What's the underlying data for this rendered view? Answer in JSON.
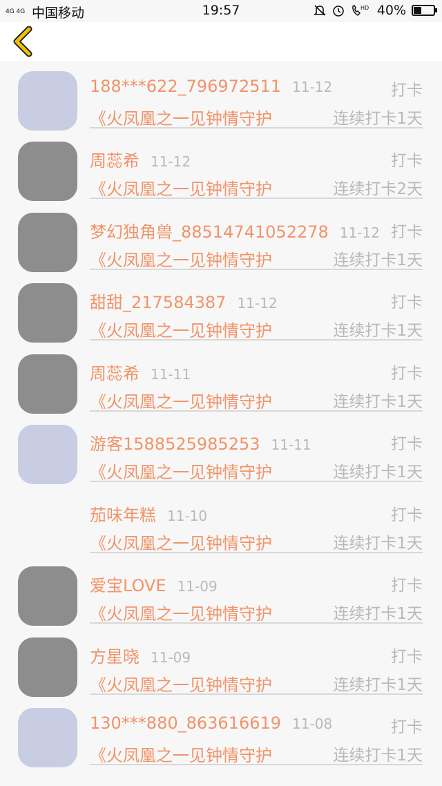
{
  "status_bar": {
    "signal": "4G 4G",
    "carrier": "中国移动",
    "time": "19:57",
    "icons": [
      "silent-icon",
      "alarm-icon",
      "hd-call-icon"
    ],
    "hd_label": "HD",
    "battery": "40%",
    "battery_level": 0.4
  },
  "header": {
    "back_icon": "chevron-left-icon",
    "accent": "#f2c200"
  },
  "rows": [
    {
      "name": "",
      "date": "",
      "book": "《火凤凰之一见钟情守护",
      "action": "",
      "streak": "连续打卡1天",
      "avatar": "photo"
    },
    {
      "name": "188***622_796972511",
      "date": "11-12",
      "book": "《火凤凰之一见钟情守护",
      "action": "打卡",
      "streak": "连续打卡1天",
      "avatar": "default"
    },
    {
      "name": "周蕊希",
      "date": "11-12",
      "book": "《火凤凰之一见钟情守护",
      "action": "打卡",
      "streak": "连续打卡2天",
      "avatar": "photo"
    },
    {
      "name": "梦幻独角兽_88514741052278",
      "date": "11-12",
      "book": "《火凤凰之一见钟情守护",
      "action": "打卡",
      "streak": "连续打卡1天",
      "avatar": "photo"
    },
    {
      "name": "甜甜_217584387",
      "date": "11-12",
      "book": "《火凤凰之一见钟情守护",
      "action": "打卡",
      "streak": "连续打卡1天",
      "avatar": "photo"
    },
    {
      "name": "周蕊希",
      "date": "11-11",
      "book": "《火凤凰之一见钟情守护",
      "action": "打卡",
      "streak": "连续打卡1天",
      "avatar": "photo"
    },
    {
      "name": "游客1588525985253",
      "date": "11-11",
      "book": "《火凤凰之一见钟情守护",
      "action": "打卡",
      "streak": "连续打卡1天",
      "avatar": "default"
    },
    {
      "name": "茄味年糕",
      "date": "11-10",
      "book": "《火凤凰之一见钟情守护",
      "action": "打卡",
      "streak": "连续打卡1天",
      "avatar": "none"
    },
    {
      "name": "爱宝LOVE",
      "date": "11-09",
      "book": "《火凤凰之一见钟情守护",
      "action": "打卡",
      "streak": "连续打卡1天",
      "avatar": "photo"
    },
    {
      "name": "方星晓",
      "date": "11-09",
      "book": "《火凤凰之一见钟情守护",
      "action": "打卡",
      "streak": "连续打卡1天",
      "avatar": "photo"
    },
    {
      "name": "130***880_863616619",
      "date": "11-08",
      "book": "《火凤凰之一见钟情守护",
      "action": "打卡",
      "streak": "连续打卡1天",
      "avatar": "default"
    }
  ],
  "colors": {
    "name": "#f0946a",
    "meta": "#b9b9b9",
    "divider": "#d8d8d8",
    "background": "#f7f7f7"
  }
}
